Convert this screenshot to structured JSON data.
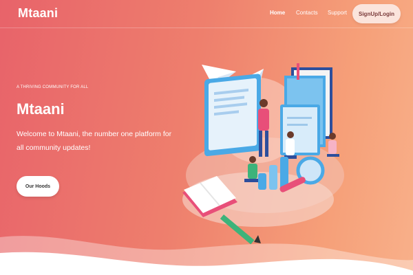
{
  "header": {
    "brand": "Mtaani",
    "nav": [
      {
        "label": "Home",
        "active": true
      },
      {
        "label": "Contacts",
        "active": false
      },
      {
        "label": "Support",
        "active": false
      }
    ],
    "signup_label": "SignUp/Login"
  },
  "hero": {
    "tagline": "A THRIVING COMMUNITY FOR ALL",
    "title": "Mtaani",
    "description": "Welcome to Mtaani, the number one platform for all community updates!",
    "cta_label": "Our Hoods"
  },
  "colors": {
    "gradient_start": "#e8636a",
    "gradient_end": "#f8b08a",
    "accent_blue": "#4aa9e6",
    "accent_pink": "#e84f79"
  },
  "icons": {
    "illustration": "community-learning-illustration"
  }
}
